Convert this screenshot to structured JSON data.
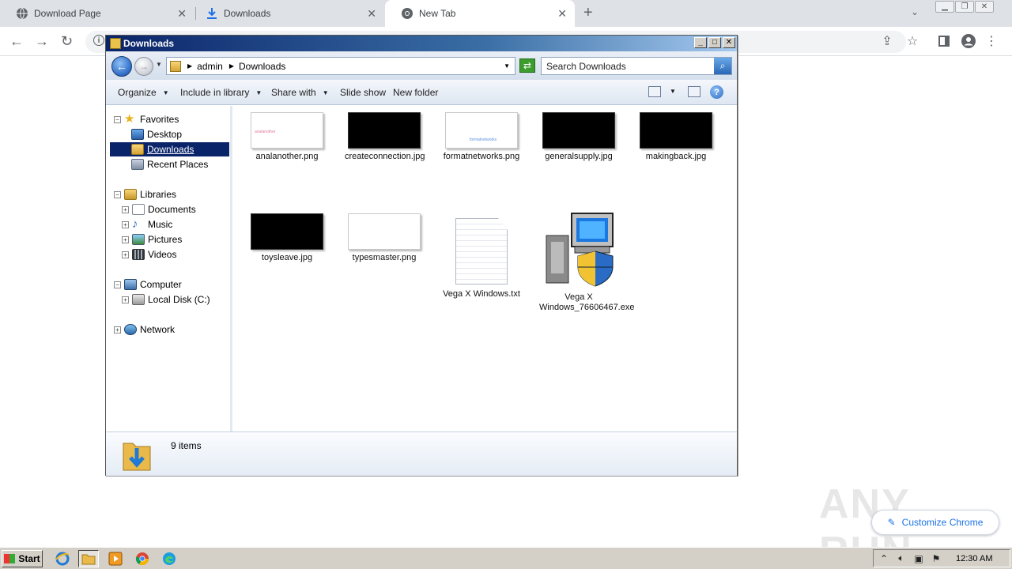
{
  "browser": {
    "tabs": [
      {
        "label": "Download Page",
        "icon": "globe-icon"
      },
      {
        "label": "Downloads",
        "icon": "download-icon"
      },
      {
        "label": "New Tab",
        "icon": "chrome-icon"
      }
    ],
    "customize_label": "Customize Chrome"
  },
  "explorer": {
    "title": "Downloads",
    "breadcrumbs": [
      "admin",
      "Downloads"
    ],
    "search_placeholder": "Search Downloads",
    "commands": [
      "Organize",
      "Include in library",
      "Share with",
      "Slide show",
      "New folder"
    ],
    "nav": {
      "favorites": "Favorites",
      "desktop": "Desktop",
      "downloads": "Downloads",
      "recent": "Recent Places",
      "libraries": "Libraries",
      "documents": "Documents",
      "music": "Music",
      "pictures": "Pictures",
      "videos": "Videos",
      "computer": "Computer",
      "localdisk": "Local Disk (C:)",
      "network": "Network"
    },
    "files": [
      {
        "name": "analanother.png",
        "thumb_text": "analanother"
      },
      {
        "name": "createconnection.jpg"
      },
      {
        "name": "formatnetworks.png",
        "thumb_text": "formatnetworks"
      },
      {
        "name": "generalsupply.jpg"
      },
      {
        "name": "makingback.jpg"
      },
      {
        "name": "toysleave.jpg"
      },
      {
        "name": "typesmaster.png"
      },
      {
        "name": "Vega X Windows.txt"
      },
      {
        "name": "Vega X Windows_76606467.exe"
      }
    ],
    "status": "9 items"
  },
  "watermark": "ANY RUN",
  "taskbar": {
    "start": "Start",
    "clock": "12:30 AM"
  }
}
